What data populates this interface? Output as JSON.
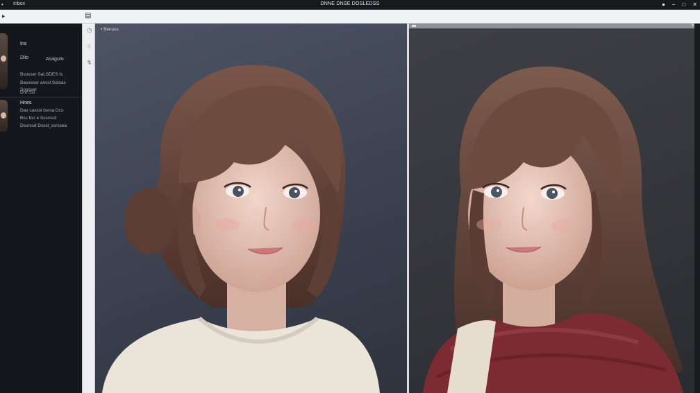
{
  "titlebar": {
    "menu_glyph": "•",
    "app_name": "Inbox",
    "window_title": "DNNE DNSE DOSLEDSS",
    "controls": [
      "●",
      "−",
      "□",
      "✕"
    ]
  },
  "toolbar": {
    "left_glyph": "▸",
    "mid_glyph": "▤"
  },
  "sidebar": {
    "entries": [
      {
        "title": "Ins",
        "sub_left": "Dlio",
        "sub_right": "Asaguto",
        "lines": [
          "Bsosser SaLSDES ts",
          "Basseser ancsl Sotsas",
          "Sogsser",
          "Dnt Ssl"
        ]
      },
      {
        "title": "Hnes",
        "lines": [
          "Das casssl bsrsa Dcs",
          "Bsc bsr e Sssrscd",
          "Dssrssd Dsssl_ssrssea"
        ]
      }
    ]
  },
  "rail": {
    "icons": [
      "clock-icon",
      "circle-icon",
      "pin-icon"
    ]
  },
  "panels": {
    "left_label": "▪ Benuss",
    "right_close": "✕"
  },
  "colors": {
    "panel_a_bg": "#434a58",
    "panel_b_bg": "#36373c",
    "hair": "#6b4a40",
    "skin": "#e8c9bd",
    "sweater": "#ece6dc",
    "scarf": "#7a2a30"
  }
}
